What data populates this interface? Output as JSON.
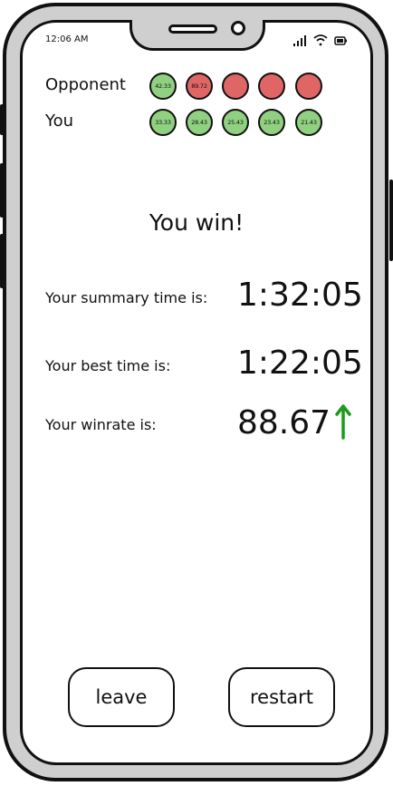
{
  "status": {
    "time": "12:06 AM"
  },
  "score": {
    "opponent_label": "Opponent",
    "you_label": "You",
    "opponent_times": [
      "42.33",
      "89.72",
      "",
      "",
      ""
    ],
    "opponent_states": [
      "won",
      "lost",
      "pending",
      "pending",
      "pending"
    ],
    "you_times": [
      "33.33",
      "28.43",
      "25.43",
      "23.43",
      "21.43"
    ],
    "colors": {
      "green": "#8fd180",
      "red": "#e06666"
    }
  },
  "result": {
    "title": "You win!"
  },
  "stats": {
    "summary_label": "Your summary time is:",
    "summary_value": "1:32:05",
    "best_label": "Your best time is:",
    "best_value": "1:22:05",
    "winrate_label": "Your winrate is:",
    "winrate_value": "88.67",
    "winrate_trend": "up",
    "trend_color": "#1a9c1a"
  },
  "actions": {
    "leave_label": "leave",
    "restart_label": "restart"
  }
}
